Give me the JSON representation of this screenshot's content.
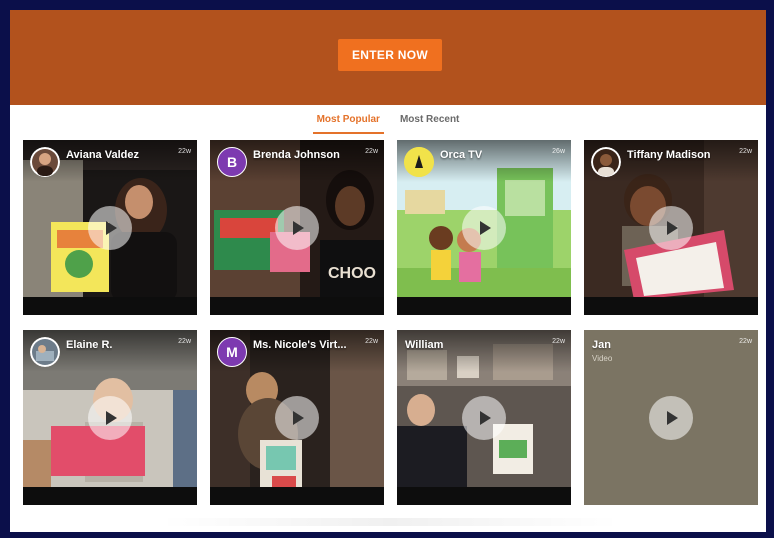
{
  "banner": {
    "button_label": "ENTER NOW",
    "color": "#b2521d",
    "button_color": "#f0701f"
  },
  "tabs": [
    {
      "label": "Most Popular",
      "active": true
    },
    {
      "label": "Most Recent",
      "active": false
    }
  ],
  "accent_color": "#e4722a",
  "cards": [
    {
      "name": "Aviana Valdez",
      "time": "22w",
      "avatar_type": "photo",
      "avatar_letter": "",
      "avatar_color": "#6b4a3a"
    },
    {
      "name": "Brenda Johnson",
      "time": "22w",
      "avatar_type": "letter",
      "avatar_letter": "B",
      "avatar_color": "#7d3ab0"
    },
    {
      "name": "Orca TV",
      "time": "26w",
      "avatar_type": "logo",
      "avatar_letter": "",
      "avatar_color": "#f1e24a"
    },
    {
      "name": "Tiffany Madison",
      "time": "22w",
      "avatar_type": "photo",
      "avatar_letter": "",
      "avatar_color": "#3a2418"
    },
    {
      "name": "Elaine R.",
      "time": "22w",
      "avatar_type": "photo",
      "avatar_letter": "",
      "avatar_color": "#6d7c8a"
    },
    {
      "name": "Ms. Nicole's Virt...",
      "time": "22w",
      "avatar_type": "letter",
      "avatar_letter": "M",
      "avatar_color": "#7d3ab0"
    },
    {
      "name": "William",
      "time": "22w",
      "avatar_type": "none",
      "avatar_letter": "",
      "avatar_color": ""
    },
    {
      "name": "Jan",
      "subtitle": "Video",
      "time": "22w",
      "avatar_type": "none",
      "avatar_letter": "",
      "avatar_color": ""
    }
  ]
}
